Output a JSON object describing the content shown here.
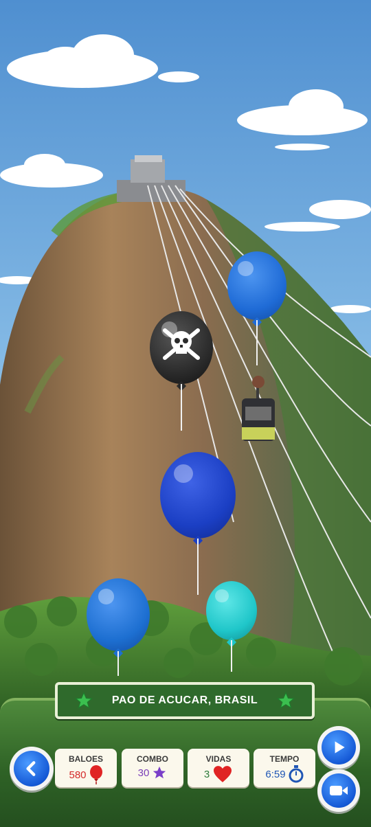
{
  "location": {
    "name": "PAO DE ACUCAR, BRASIL"
  },
  "stats": [
    {
      "label": "BALOES",
      "value": "580",
      "value_color": "#d42a2a",
      "icon": "red-balloon-icon"
    },
    {
      "label": "COMBO",
      "value": "30",
      "value_color": "#7a3fb8",
      "icon": "purple-star-icon"
    },
    {
      "label": "VIDAS",
      "value": "3",
      "value_color": "#2d7a3a",
      "icon": "red-heart-icon"
    },
    {
      "label": "TEMPO",
      "value": "6:59",
      "value_color": "#1f56b5",
      "icon": "stopwatch-icon"
    }
  ],
  "balloons": [
    {
      "kind": "bomb",
      "color": "#2b2b2b",
      "icon": "skull-crossbones-icon"
    },
    {
      "kind": "normal",
      "color": "#1f6bd6"
    },
    {
      "kind": "normal",
      "color": "#1b3fc4"
    },
    {
      "kind": "normal",
      "color": "#1d6fd1"
    },
    {
      "kind": "normal",
      "color": "#1fc6c9"
    }
  ],
  "colors": {
    "sky": "#6aa6dc",
    "hud_green": "#2f6326",
    "banner_green": "#2f6a2c",
    "star_green": "#3bbf4f",
    "button_blue": "#1559d6"
  }
}
